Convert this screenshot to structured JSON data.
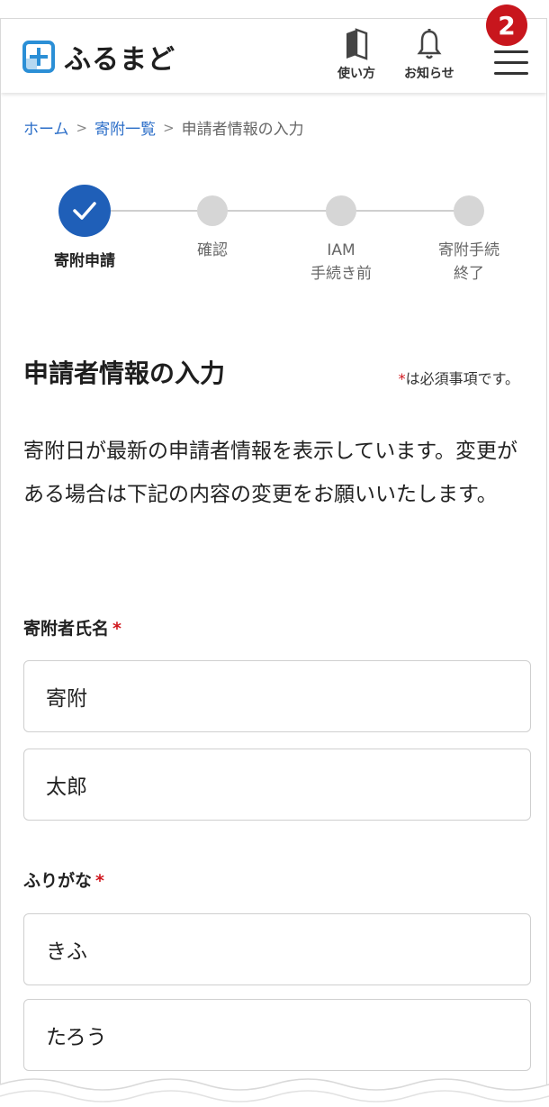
{
  "header": {
    "logo_text": "ふるまど",
    "guide_label": "使い方",
    "notice_label": "お知らせ",
    "badge_count": "2",
    "brand_color": "#2b8fd6"
  },
  "breadcrumb": {
    "home": "ホーム",
    "list": "寄附一覧",
    "current": "申請者情報の入力",
    "separator": ">"
  },
  "steps": [
    {
      "label": "寄附申請",
      "state": "done"
    },
    {
      "label": "確認",
      "state": "pending"
    },
    {
      "label": "IAM\n手続き前",
      "state": "pending"
    },
    {
      "label": "寄附手続\n終了",
      "state": "pending"
    }
  ],
  "section": {
    "title": "申請者情報の入力",
    "required_mark": "*",
    "required_note": "は必須事項です。",
    "intro": "寄附日が最新の申請者情報を表示しています。変更がある場合は下記の内容の変更をお願いいたします。"
  },
  "form": {
    "name_label": "寄附者氏名",
    "last_name": "寄附",
    "first_name": "太郎",
    "kana_label": "ふりがな",
    "last_kana": "きふ",
    "first_kana": "たろう",
    "required_mark": "*"
  },
  "colors": {
    "accent": "#1f5fb8",
    "required": "#d0161d",
    "badge": "#c8161d",
    "link": "#2b6ec8"
  }
}
